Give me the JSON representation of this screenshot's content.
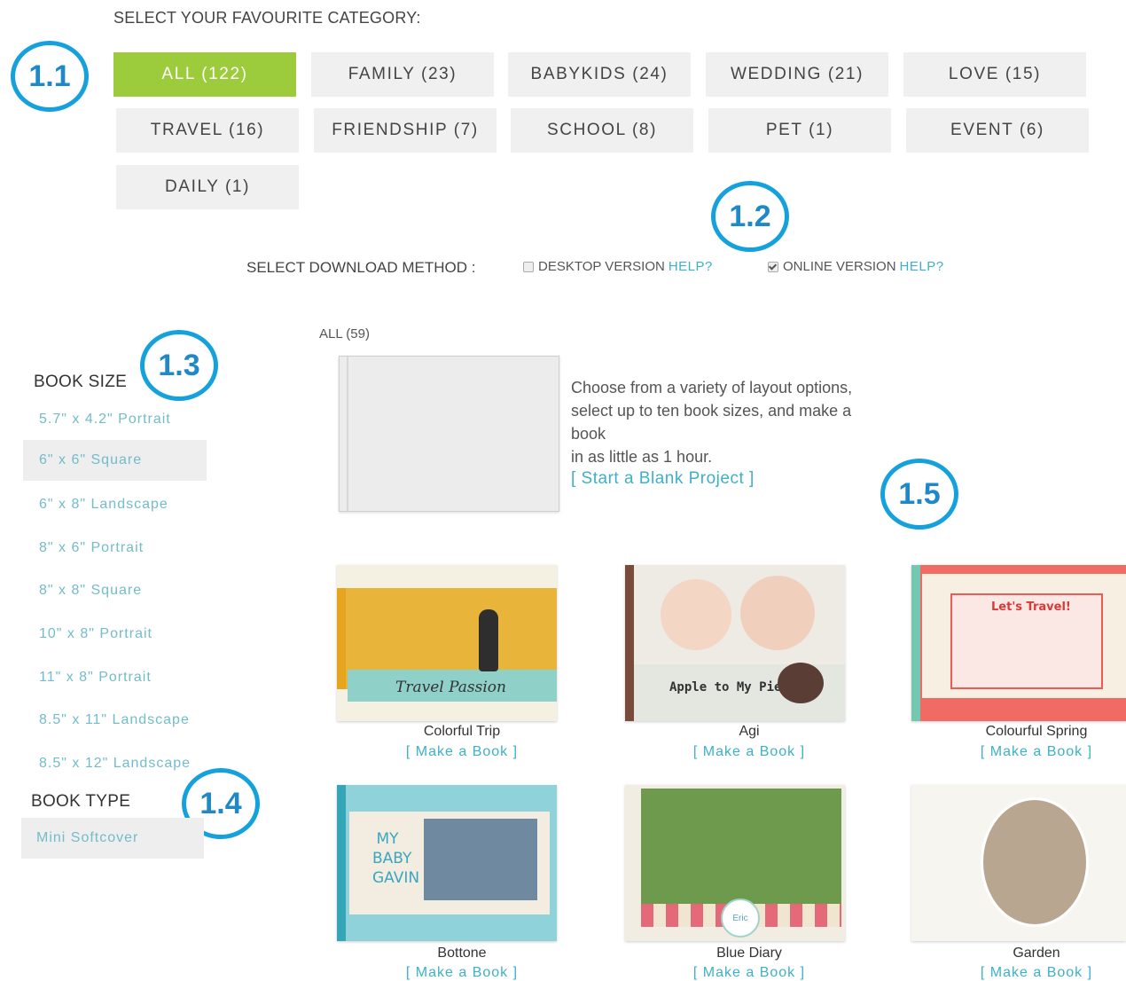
{
  "category": {
    "title": "SELECT YOUR FAVOURITE CATEGORY:",
    "items": [
      {
        "label": "ALL (122)",
        "active": true
      },
      {
        "label": "FAMILY (23)"
      },
      {
        "label": "BABYKIDS (24)"
      },
      {
        "label": "WEDDING (21)"
      },
      {
        "label": "LOVE (15)"
      },
      {
        "label": "TRAVEL (16)"
      },
      {
        "label": "FRIENDSHIP (7)"
      },
      {
        "label": "SCHOOL (8)"
      },
      {
        "label": "PET (1)"
      },
      {
        "label": "EVENT (6)"
      },
      {
        "label": "DAILY (1)"
      }
    ]
  },
  "badges": [
    "1.1",
    "1.2",
    "1.3",
    "1.4",
    "1.5"
  ],
  "download": {
    "label": "SELECT DOWNLOAD METHOD :",
    "desktop": {
      "label": "DESKTOP VERSION",
      "help": "HELP?",
      "checked": false
    },
    "online": {
      "label": "ONLINE VERSION",
      "help": "HELP?",
      "checked": true
    }
  },
  "sidebar": {
    "book_size_title": "BOOK SIZE",
    "sizes": [
      "5.7\" x 4.2\" Portrait",
      "6\" x 6\" Square",
      "6\" x 8\" Landscape",
      "8\" x 6\" Portrait",
      "8\" x 8\" Square",
      "10\" x 8\" Portrait",
      "11\" x 8\" Portrait",
      "8.5\" x 11\" Landscape",
      "8.5\" x 12\" Landscape"
    ],
    "active_size": "6\" x 6\" Square",
    "book_type_title": "BOOK TYPE",
    "types": [
      "Mini Softcover"
    ]
  },
  "main": {
    "all_label": "ALL (59)",
    "blank": {
      "desc_lines": [
        "Choose from a variety of layout options,",
        "select up to ten book sizes, and make a book",
        "in as little as 1 hour."
      ],
      "link": "[ Start a Blank Project ]"
    },
    "books": [
      {
        "name": "Colorful Trip",
        "link": "[ Make a Book ]",
        "cover_text": "Travel Passion"
      },
      {
        "name": "Agi",
        "link": "[ Make a Book ]",
        "cover_text": "Apple to My Pie !"
      },
      {
        "name": "Colourful Spring",
        "link": "[ Make a Book ]",
        "cover_text": "Let's Travel!"
      },
      {
        "name": "Bottone",
        "link": "[ Make a Book ]",
        "cover_text": "MY BABY GAVIN"
      },
      {
        "name": "Blue Diary",
        "link": "[ Make a Book ]",
        "cover_text": "Eric"
      },
      {
        "name": "Garden",
        "link": "[ Make a Book ]",
        "cover_text": ""
      }
    ]
  },
  "colors": {
    "accent_green": "#9ccb3b",
    "link_teal": "#3db1c8",
    "badge_blue": "#14a1dc"
  }
}
